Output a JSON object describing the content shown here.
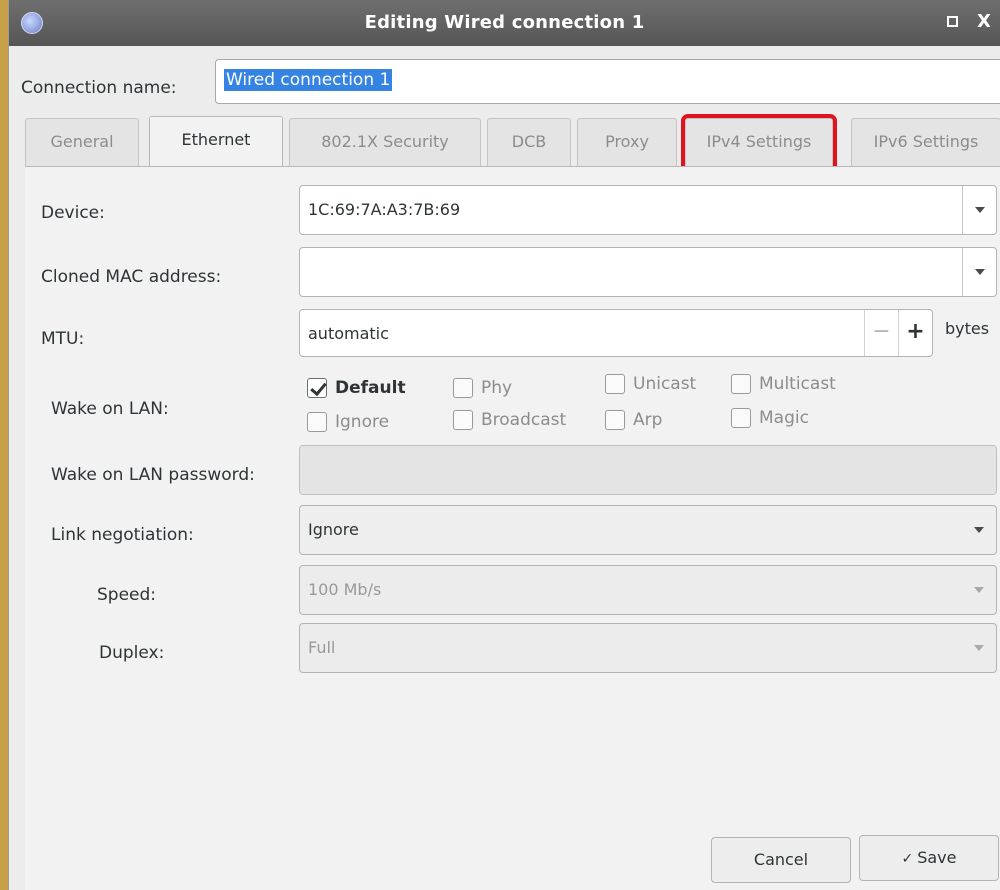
{
  "window": {
    "title": "Editing Wired connection 1",
    "maximize_icon": "maximize-icon",
    "close_glyph": "X"
  },
  "connection": {
    "label": "Connection name:",
    "value": "Wired connection 1"
  },
  "tabs": [
    {
      "label": "General",
      "active": false
    },
    {
      "label": "Ethernet",
      "active": true
    },
    {
      "label": "802.1X Security",
      "active": false
    },
    {
      "label": "DCB",
      "active": false
    },
    {
      "label": "Proxy",
      "active": false
    },
    {
      "label": "IPv4 Settings",
      "active": false,
      "highlighted": true
    },
    {
      "label": "IPv6 Settings",
      "active": false
    }
  ],
  "ethernet": {
    "device_label": "Device:",
    "device_value": "1C:69:7A:A3:7B:69",
    "cloned_mac_label": "Cloned MAC address:",
    "cloned_mac_value": "",
    "mtu_label": "MTU:",
    "mtu_value": "automatic",
    "mtu_minus": "−",
    "mtu_plus": "+",
    "mtu_unit": "bytes",
    "wol_label": "Wake on LAN:",
    "wol_options": [
      {
        "label": "Default",
        "checked": true
      },
      {
        "label": "Phy",
        "checked": false
      },
      {
        "label": "Unicast",
        "checked": false
      },
      {
        "label": "Multicast",
        "checked": false
      },
      {
        "label": "Ignore",
        "checked": false
      },
      {
        "label": "Broadcast",
        "checked": false
      },
      {
        "label": "Arp",
        "checked": false
      },
      {
        "label": "Magic",
        "checked": false
      }
    ],
    "wol_password_label": "Wake on LAN password:",
    "wol_password_value": "",
    "link_neg_label": "Link negotiation:",
    "link_neg_value": "Ignore",
    "speed_label": "Speed:",
    "speed_value": "100 Mb/s",
    "duplex_label": "Duplex:",
    "duplex_value": "Full"
  },
  "footer": {
    "cancel_label": "Cancel",
    "save_check": "✓",
    "save_label": "Save"
  },
  "colors": {
    "highlight_outline": "#e0141e",
    "selection": "#3584e4",
    "titlebar": "#5f5f5f"
  }
}
